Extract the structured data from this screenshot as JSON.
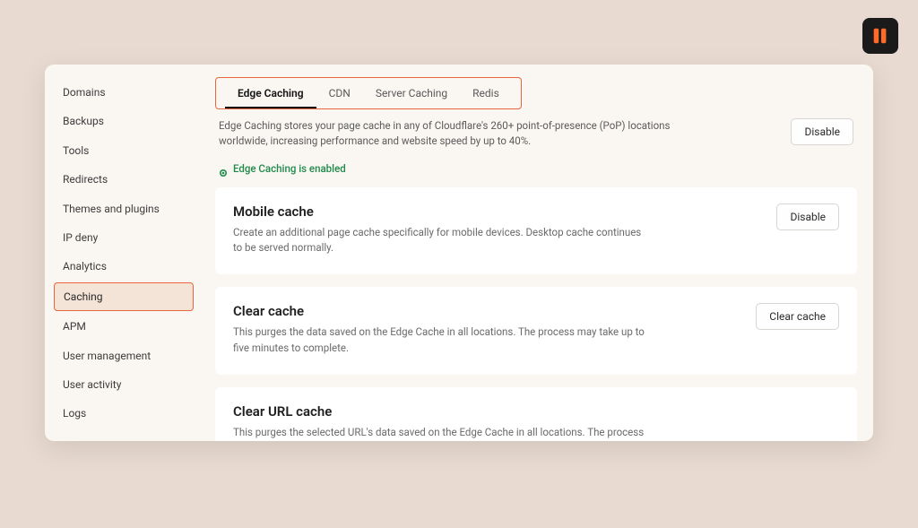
{
  "brand": {
    "name": "logo"
  },
  "sidebar": {
    "items": [
      {
        "label": "Domains"
      },
      {
        "label": "Backups"
      },
      {
        "label": "Tools"
      },
      {
        "label": "Redirects"
      },
      {
        "label": "Themes and plugins"
      },
      {
        "label": "IP deny"
      },
      {
        "label": "Analytics"
      },
      {
        "label": "Caching",
        "active": true
      },
      {
        "label": "APM"
      },
      {
        "label": "User management"
      },
      {
        "label": "User activity"
      },
      {
        "label": "Logs"
      }
    ]
  },
  "tabs": [
    {
      "label": "Edge Caching",
      "active": true
    },
    {
      "label": "CDN"
    },
    {
      "label": "Server Caching"
    },
    {
      "label": "Redis"
    }
  ],
  "intro": {
    "text": "Edge Caching stores your page cache in any of Cloudflare's 260+ point-of-presence (PoP) locations worldwide, increasing performance and website speed by up to 40%.",
    "button": "Disable",
    "status": "Edge Caching is enabled"
  },
  "cards": {
    "mobile": {
      "title": "Mobile cache",
      "desc": "Create an additional page cache specifically for mobile devices. Desktop cache continues to be served normally.",
      "button": "Disable"
    },
    "clear": {
      "title": "Clear cache",
      "desc": "This purges the data saved on the Edge Cache in all locations. The process may take up to five minutes to complete.",
      "button": "Clear cache"
    },
    "clearurl": {
      "title": "Clear URL cache",
      "desc": "This purges the selected URL's data saved on the Edge Cache in all locations. The process may take up to five minutes to complete."
    }
  }
}
